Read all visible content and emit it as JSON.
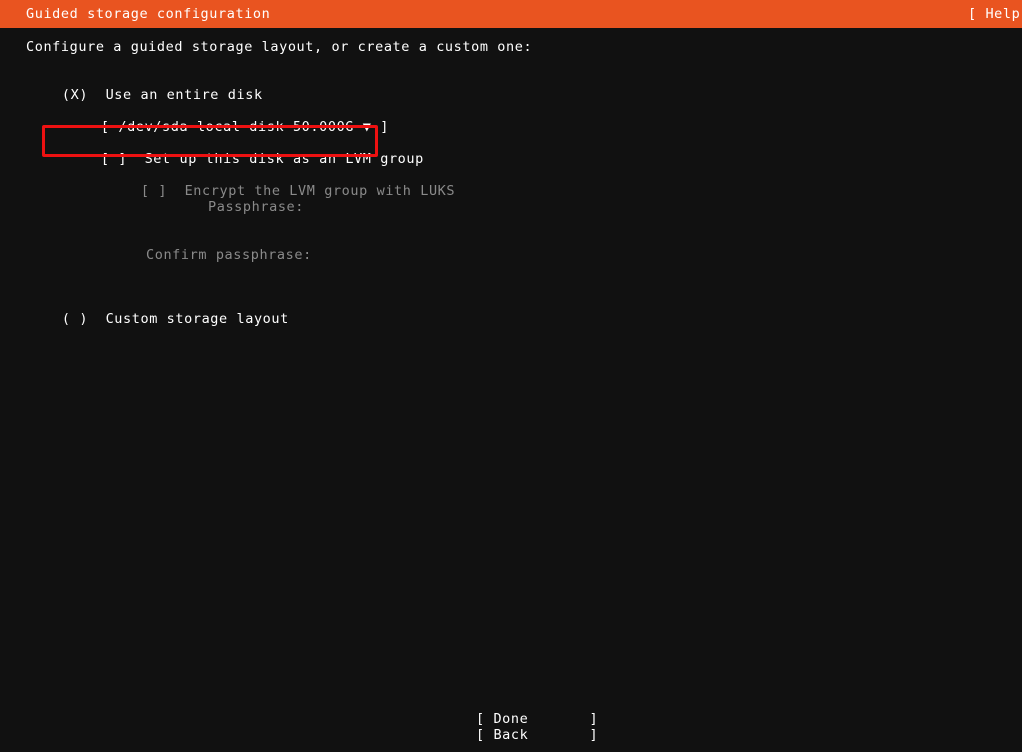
{
  "header": {
    "title": "Guided storage configuration",
    "help_label": "[ Help"
  },
  "main": {
    "instruction": "Configure a guided storage layout, or create a custom one:",
    "options": {
      "entire_disk": {
        "marker": "(X)",
        "label": "Use an entire disk",
        "selected": true
      },
      "custom_layout": {
        "marker": "( )",
        "label": "Custom storage layout",
        "selected": false
      }
    },
    "disk_selector": {
      "open_bracket": "[",
      "value": "/dev/sda local disk 50.000G",
      "arrow": "▼",
      "close_bracket": "]"
    },
    "lvm_checkbox": {
      "marker": "[ ]",
      "label": "Set up this disk as an LVM group",
      "checked": false,
      "highlighted": true
    },
    "luks_checkbox": {
      "marker": "[ ]",
      "label": "Encrypt the LVM group with LUKS",
      "checked": false,
      "disabled": true
    },
    "passphrase_label": "Passphrase:",
    "confirm_passphrase_label": "Confirm passphrase:"
  },
  "footer": {
    "done_button": "[ Done       ]",
    "back_button": "[ Back       ]"
  },
  "colors": {
    "accent_orange": "#e95420",
    "background": "#111111",
    "text_bright": "#ffffff",
    "text_dim": "#8a8a8a",
    "annotation_red": "#ee1111"
  }
}
